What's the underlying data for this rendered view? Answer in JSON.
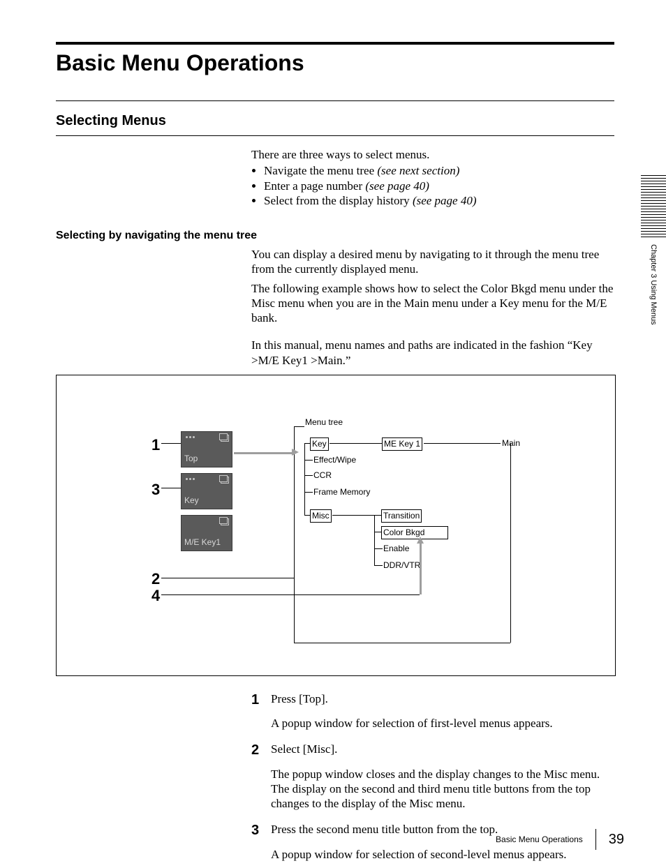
{
  "header": {
    "title": "Basic Menu Operations"
  },
  "sidebar": {
    "chapter_label": "Chapter 3   Using Menus"
  },
  "section": {
    "heading": "Selecting Menus",
    "intro": "There are three ways to select menus.",
    "bullets": {
      "b1": {
        "text": "Navigate the menu tree ",
        "ref": "(see next section)"
      },
      "b2": {
        "text": "Enter a page number ",
        "ref": "(see page 40)"
      },
      "b3": {
        "text": "Select from the display history ",
        "ref": "(see page 40)"
      }
    },
    "sub": {
      "heading": "Selecting by navigating the menu tree",
      "p1": "You can display a desired menu by navigating to it through the menu tree from the currently displayed menu.",
      "p2": "The following example shows how to select the Color Bkgd menu under the Misc menu when you are in the Main menu under a Key menu for the M/E bank.",
      "p3": "In this manual, menu names and paths are indicated in the fashion “Key >M/E Key1 >Main.”"
    }
  },
  "diagram": {
    "tree_label": "Menu tree",
    "numbers": {
      "n1": "1",
      "n2": "2",
      "n3": "3",
      "n4": "4"
    },
    "title_buttons": {
      "top": "Top",
      "key": "Key",
      "mekey1": "M/E Key1"
    },
    "lvl1": {
      "key": "Key",
      "effect_wipe": "Effect/Wipe",
      "ccr": "CCR",
      "frame_memory": "Frame Memory",
      "misc": "Misc"
    },
    "key_children": {
      "mekey1": "ME Key 1",
      "main": "Main"
    },
    "misc_children": {
      "transition": "Transition",
      "color_bkgd": "Color Bkgd",
      "enable": "Enable",
      "ddrvtr": "DDR/VTR"
    }
  },
  "steps": {
    "s1": {
      "num": "1",
      "text": "Press [Top].",
      "sub": "A popup window for selection of first-level menus appears."
    },
    "s2": {
      "num": "2",
      "text": "Select [Misc].",
      "sub": "The popup window closes and the display changes to the Misc menu. The display on the second and third menu title buttons from the top changes to the display of the Misc menu."
    },
    "s3": {
      "num": "3",
      "text": "Press the second menu title button from the top.",
      "sub": "A popup window for selection of second-level menus appears."
    }
  },
  "footer": {
    "section_title": "Basic Menu Operations",
    "page_number": "39"
  }
}
